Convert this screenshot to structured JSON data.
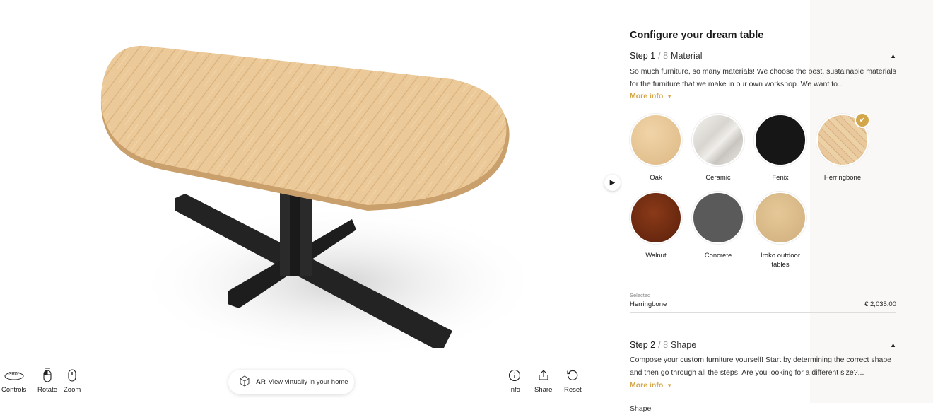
{
  "viewer": {
    "controls": [
      {
        "label": "Controls",
        "icon": "360-icon"
      },
      {
        "label": "Rotate",
        "icon": "mouse-left-click-icon"
      },
      {
        "label": "Zoom",
        "icon": "mouse-scroll-icon"
      }
    ],
    "controls_icon_text": "360°",
    "ar": {
      "tag": "AR",
      "text": "View virtually in your home"
    },
    "actions": [
      {
        "label": "Info",
        "icon": "info-icon"
      },
      {
        "label": "Share",
        "icon": "share-icon"
      },
      {
        "label": "Reset",
        "icon": "reset-icon"
      }
    ]
  },
  "panel": {
    "title": "Configure your dream table",
    "step1": {
      "num": "Step 1",
      "of": "/ 8",
      "name": "Material",
      "desc": "So much furniture, so many materials! We choose the best, sustainable materials for the furniture that we make in our own workshop. We want to...",
      "more": "More info"
    },
    "swatches": [
      {
        "label": "Oak",
        "color": "#e6c79c"
      },
      {
        "label": "Ceramic",
        "color": "#e8e6e2"
      },
      {
        "label": "Fenix",
        "color": "#161616"
      },
      {
        "label": "Herringbone",
        "color": "#e2c196",
        "selected": true
      },
      {
        "label": "Walnut",
        "color": "#6a2a10"
      },
      {
        "label": "Concrete",
        "color": "#5a5a5a"
      },
      {
        "label": "Iroko outdoor tables",
        "color": "#d9b987"
      }
    ],
    "selected": {
      "label": "Selected",
      "value": "Herringbone",
      "price": "€ 2,035.00"
    },
    "step2": {
      "num": "Step 2",
      "of": "/ 8",
      "name": "Shape",
      "desc": "Compose your custom furniture yourself! Start by determining the correct shape and then go through all the steps. Are you looking for a different size?...",
      "more": "More info"
    },
    "shape_label": "Shape"
  }
}
